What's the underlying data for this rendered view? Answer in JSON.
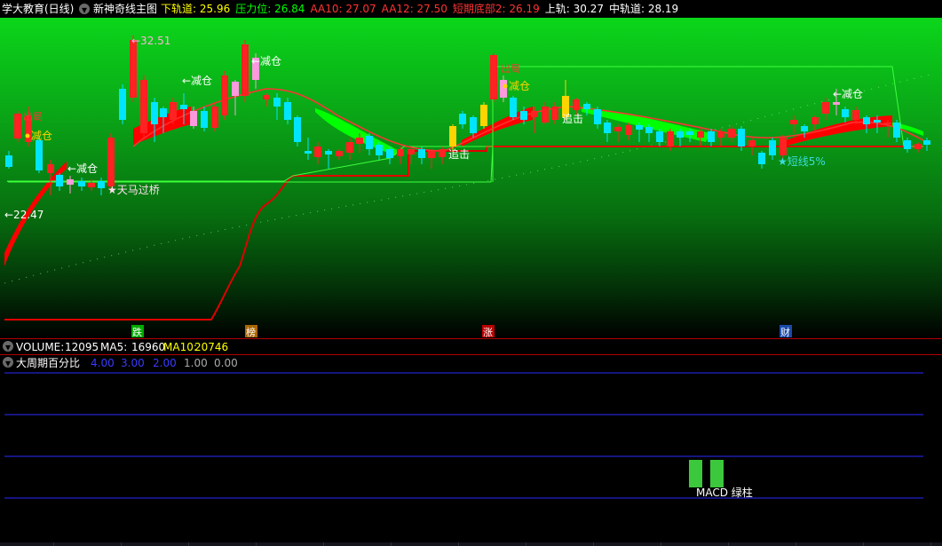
{
  "header": {
    "app_title": "学大教育(日线)",
    "indicator_name": "新神奇线主图",
    "items": [
      {
        "label": "下轨道:",
        "value": "25.96",
        "color": "#ffff00"
      },
      {
        "label": "压力位:",
        "value": "26.84",
        "color": "#00ff00"
      },
      {
        "label": "AA10:",
        "value": "27.07",
        "color": "#ff3333"
      },
      {
        "label": "AA12:",
        "value": "27.50",
        "color": "#ff3333"
      },
      {
        "label": "短期底部2:",
        "value": "26.19",
        "color": "#ff3333"
      },
      {
        "label": "上轨:",
        "value": "30.27",
        "color": "#ffffff"
      },
      {
        "label": "中轨道:",
        "value": "28.19",
        "color": "#ffffff"
      }
    ]
  },
  "main_chart": {
    "price_labels": {
      "high": "32.51",
      "low": "22.47"
    },
    "annotations": {
      "reduce": "减仓",
      "out": "出局",
      "chase": "追击",
      "tianma": "天马过桥",
      "short": "短线5%"
    },
    "axis_markers": [
      "跌",
      "榜",
      "涨",
      "财"
    ]
  },
  "volume_panel": {
    "title": "VOLUME:",
    "value": "12095",
    "ma5_label": "MA5:",
    "ma5_value": "16960",
    "ma10_label": "MA10:",
    "ma10_value": "20746"
  },
  "percent_panel": {
    "title": "大周期百分比",
    "levels": [
      "4.00",
      "3.00",
      "2.00",
      "1.00",
      "0.00"
    ],
    "macd_label": "MACD 绿柱"
  },
  "colors": {
    "up": "#ff2222",
    "down": "#00e5ff",
    "pink": "#ff99dd",
    "gold": "#ffd400",
    "level_line": "#2a2aff"
  }
}
